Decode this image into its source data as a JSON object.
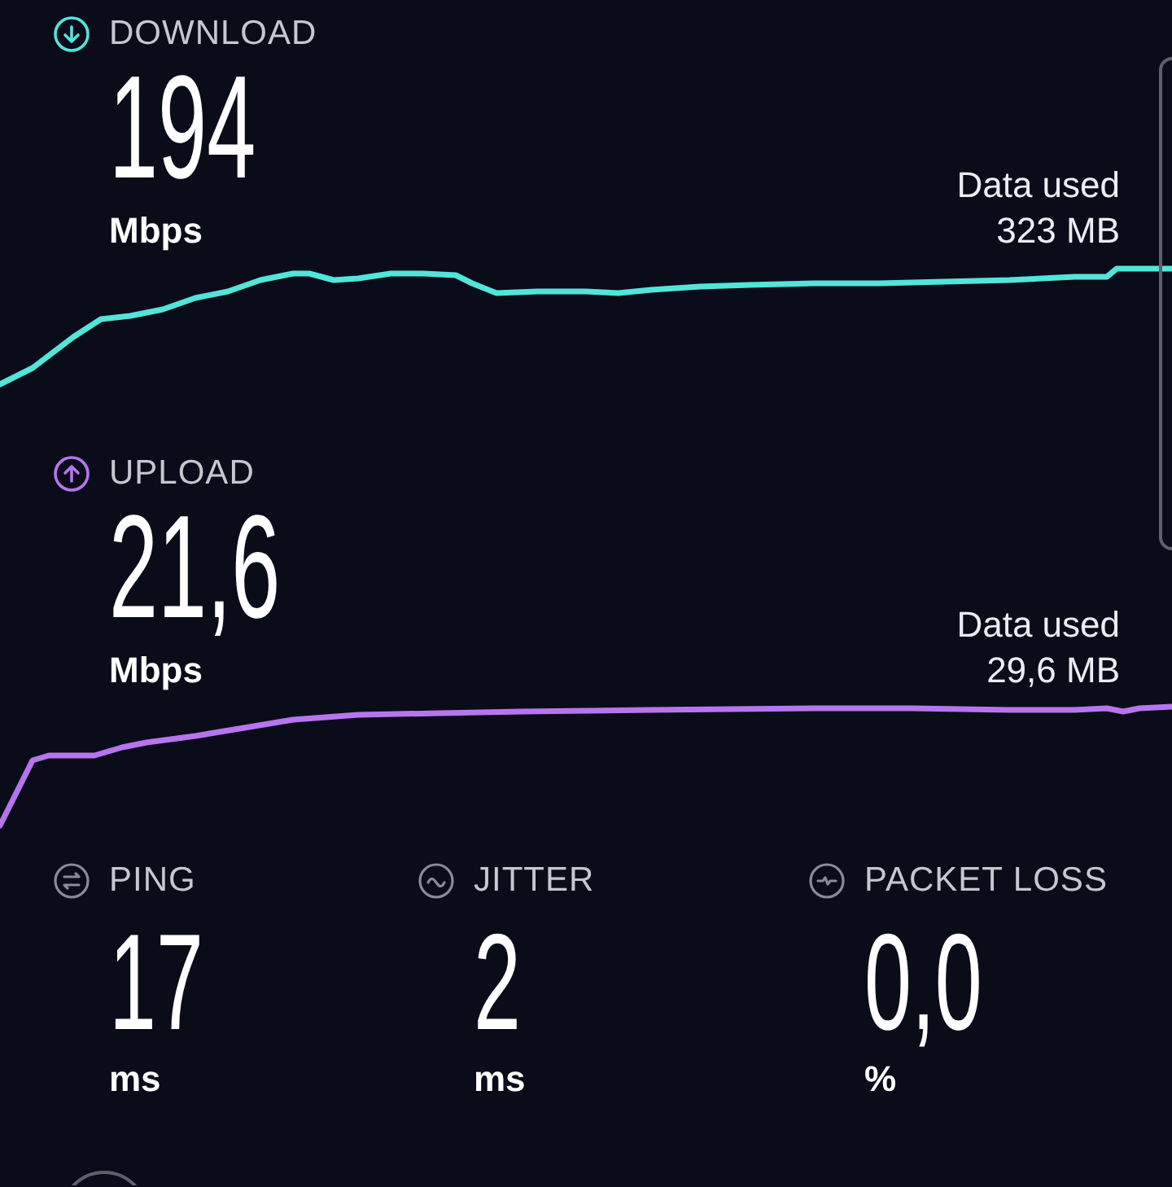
{
  "tests": [
    {
      "kind": "download",
      "color": "#52e5da",
      "label": "DOWNLOAD",
      "value": "194",
      "unit": "Mbps",
      "data_used_label": "Data used",
      "data_used": "323 MB"
    },
    {
      "kind": "upload",
      "color": "#b675ee",
      "label": "UPLOAD",
      "value": "21,6",
      "unit": "Mbps",
      "data_used_label": "Data used",
      "data_used": "29,6 MB"
    }
  ],
  "stats": [
    {
      "kind": "ping",
      "label": "PING",
      "value": "17",
      "unit": "ms"
    },
    {
      "kind": "jitter",
      "label": "JITTER",
      "value": "2",
      "unit": "ms"
    },
    {
      "kind": "packet_loss",
      "label": "PACKET LOSS",
      "value": "0,0",
      "unit": "%"
    }
  ]
}
